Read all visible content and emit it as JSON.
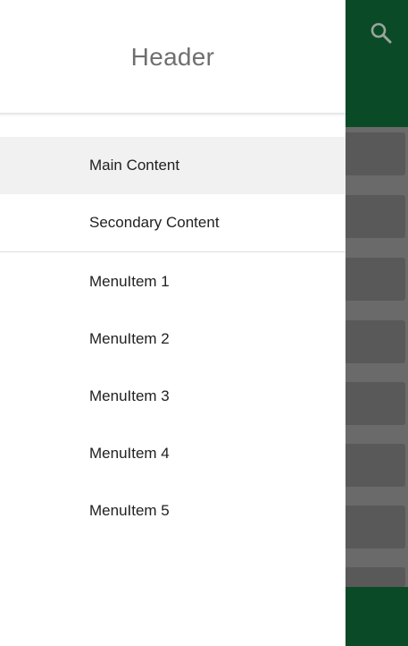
{
  "drawer": {
    "header_title": "Header",
    "primary_items": [
      {
        "label": "Main Content",
        "selected": true
      },
      {
        "label": "Secondary Content",
        "selected": false
      }
    ],
    "menu_items": [
      {
        "label": "MenuItem 1"
      },
      {
        "label": "MenuItem 2"
      },
      {
        "label": "MenuItem 3"
      },
      {
        "label": "MenuItem 4"
      },
      {
        "label": "MenuItem 5"
      }
    ]
  },
  "app": {
    "toolbar_color": "#0b4a26",
    "search_icon": "search-icon"
  },
  "colors": {
    "accent": "#0b4a26",
    "selected_item_bg": "#f1f1f1",
    "scrim_content": "#6a6a6a"
  }
}
